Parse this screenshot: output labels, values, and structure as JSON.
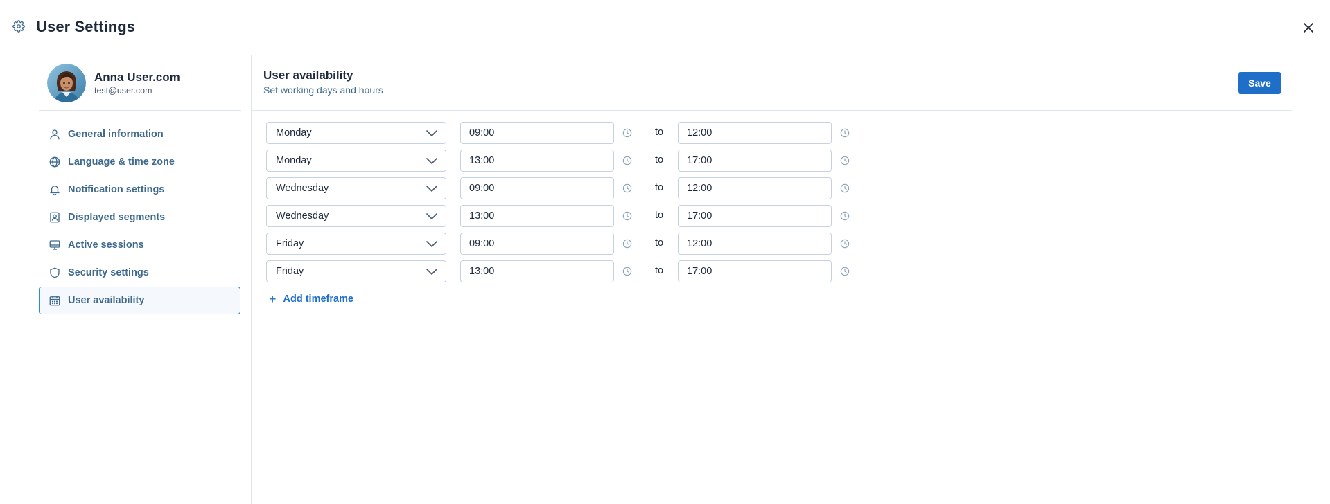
{
  "header": {
    "title": "User Settings"
  },
  "profile": {
    "name": "Anna User.com",
    "email": "test@user.com"
  },
  "sidebar": {
    "items": [
      {
        "label": "General information",
        "icon": "user-icon"
      },
      {
        "label": "Language & time zone",
        "icon": "globe-icon"
      },
      {
        "label": "Notification settings",
        "icon": "bell-icon"
      },
      {
        "label": "Displayed segments",
        "icon": "segment-icon"
      },
      {
        "label": "Active sessions",
        "icon": "monitor-icon"
      },
      {
        "label": "Security settings",
        "icon": "shield-icon"
      },
      {
        "label": "User availability",
        "icon": "calendar-icon",
        "active": true
      }
    ]
  },
  "main": {
    "title": "User availability",
    "subtitle": "Set working days and hours",
    "save_label": "Save",
    "to_label": "to",
    "rows": [
      {
        "day": "Monday",
        "from": "09:00",
        "to": "12:00"
      },
      {
        "day": "Monday",
        "from": "13:00",
        "to": "17:00"
      },
      {
        "day": "Wednesday",
        "from": "09:00",
        "to": "12:00"
      },
      {
        "day": "Wednesday",
        "from": "13:00",
        "to": "17:00"
      },
      {
        "day": "Friday",
        "from": "09:00",
        "to": "12:00"
      },
      {
        "day": "Friday",
        "from": "13:00",
        "to": "17:00"
      }
    ],
    "add_label": "Add timeframe"
  },
  "colors": {
    "accent": "#1f6fc9",
    "active_border": "#2b8ad6",
    "nav_text": "#3f6a8e",
    "border": "#c6d2df"
  }
}
